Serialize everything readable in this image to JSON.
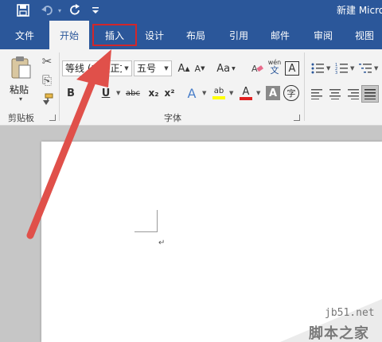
{
  "titlebar": {
    "title": "新建 Micro",
    "qat": [
      {
        "icon": "save-icon",
        "glyph": "💾"
      },
      {
        "icon": "undo-icon",
        "glyph": "↶"
      },
      {
        "icon": "undo-dropdown-icon",
        "glyph": "▾"
      },
      {
        "icon": "redo-icon",
        "glyph": "↻"
      },
      {
        "icon": "customize-qat-icon",
        "glyph": "⩦"
      }
    ]
  },
  "tabs": [
    {
      "label": "文件"
    },
    {
      "label": "开始"
    },
    {
      "label": "插入"
    },
    {
      "label": "设计"
    },
    {
      "label": "布局"
    },
    {
      "label": "引用"
    },
    {
      "label": "邮件"
    },
    {
      "label": "审阅"
    },
    {
      "label": "视图"
    }
  ],
  "ribbon": {
    "clipboard": {
      "group_label": "剪贴板",
      "paste_label": "粘贴",
      "paste_arrow": "▾",
      "cut_icon": "✂",
      "copy_icon": "⎘",
      "format_painter_icon": "🖌"
    },
    "font": {
      "group_label": "字体",
      "font_name": "等线 (中文正文",
      "font_size": "五号",
      "grow": "A",
      "shrink": "A",
      "change_case": "Aa",
      "clear_format": "✐",
      "phonetic": "wén",
      "phonetic_sub": "文",
      "char_border": "A",
      "bold": "B",
      "italic": "I",
      "underline": "U",
      "strike": "abc",
      "subscript": "x₂",
      "superscript": "x²",
      "text_effect": "A",
      "highlight": "ab",
      "font_color": "A",
      "char_shading": "A",
      "enclose": "字"
    },
    "colors": {
      "highlight_color": "#ffff00",
      "font_color": "#e02020",
      "accent": "#2b579a",
      "red_outline": "#d2262a"
    }
  },
  "watermark": {
    "site": "jb51.net",
    "name": "脚本之家"
  }
}
